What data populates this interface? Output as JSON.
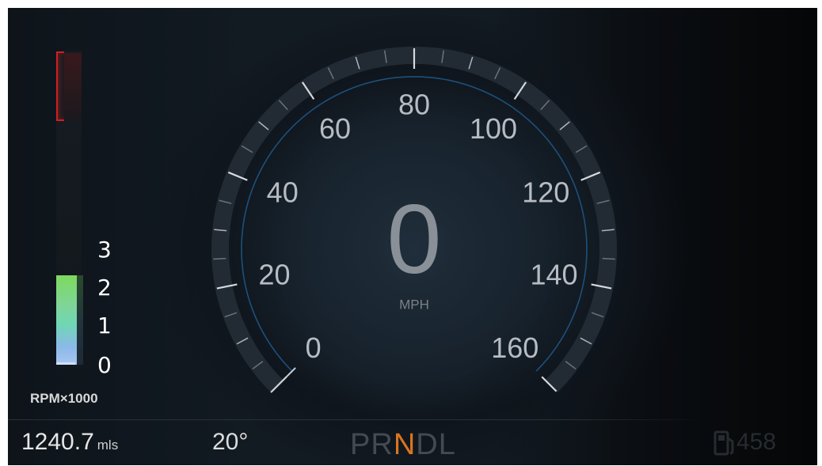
{
  "tachometer": {
    "scale": [
      "3",
      "2",
      "1",
      "0"
    ],
    "label": "RPM×1000",
    "level_rpm_thousands": 2.0,
    "colors": {
      "redline": "#d21f1f",
      "fill_top": "#7ed95e",
      "fill_mid": "#6fd7b4",
      "fill_bottom": "#a9c6f2"
    }
  },
  "speedometer": {
    "value": "0",
    "unit": "MPH",
    "scale_labels": [
      "0",
      "20",
      "40",
      "60",
      "80",
      "100",
      "120",
      "140",
      "160"
    ],
    "needle_mph": 0,
    "accent": "#1e5a8c"
  },
  "status_bar": {
    "odometer_value": "1240.7",
    "odometer_unit": "mls",
    "outside_temp": "20°",
    "gears": [
      "P",
      "R",
      "N",
      "D",
      "L"
    ],
    "active_gear": "N",
    "fuel_icon": "fuel-pump-icon",
    "range": "458"
  }
}
